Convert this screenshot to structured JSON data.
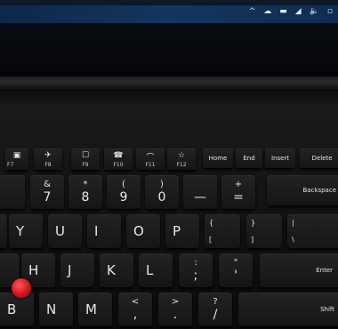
{
  "tray": {
    "up_arrow": "^",
    "mic": "◀",
    "volume": "🔈"
  },
  "fkeys": [
    {
      "icon": "▣",
      "label": "F7"
    },
    {
      "icon": "✈",
      "label": "F8"
    },
    {
      "icon": "☐",
      "label": "F9"
    },
    {
      "icon": "☎",
      "label": "F10"
    },
    {
      "icon": "⌒",
      "label": "F11"
    },
    {
      "icon": "☆",
      "label": "F12"
    }
  ],
  "nav": {
    "home": "Home",
    "end": "End",
    "insert": "Insert",
    "delete": "Delete"
  },
  "row_num": [
    {
      "top": "&",
      "bot": "7"
    },
    {
      "top": "*",
      "bot": "8"
    },
    {
      "top": "(",
      "bot": "9"
    },
    {
      "top": ")",
      "bot": "0"
    },
    {
      "top": "",
      "bot": "—"
    },
    {
      "top": "+",
      "bot": "="
    }
  ],
  "backspace": "Backspace",
  "row_q": [
    "Y",
    "U",
    "I",
    "O",
    "P"
  ],
  "brackets": [
    {
      "top": "{",
      "bot": "["
    },
    {
      "top": "}",
      "bot": "]"
    },
    {
      "top": "|",
      "bot": "\\"
    }
  ],
  "row_a": [
    "H",
    "J",
    "K",
    "L"
  ],
  "punct_a": [
    {
      "top": ":",
      "bot": ";"
    },
    {
      "top": "\"",
      "bot": "'"
    }
  ],
  "enter": "Enter",
  "row_z": [
    "B",
    "N",
    "M"
  ],
  "punct_z": [
    {
      "top": "<",
      "bot": ","
    },
    {
      "top": ">",
      "bot": "."
    },
    {
      "top": "?",
      "bot": "/"
    }
  ],
  "shift": "Shift"
}
